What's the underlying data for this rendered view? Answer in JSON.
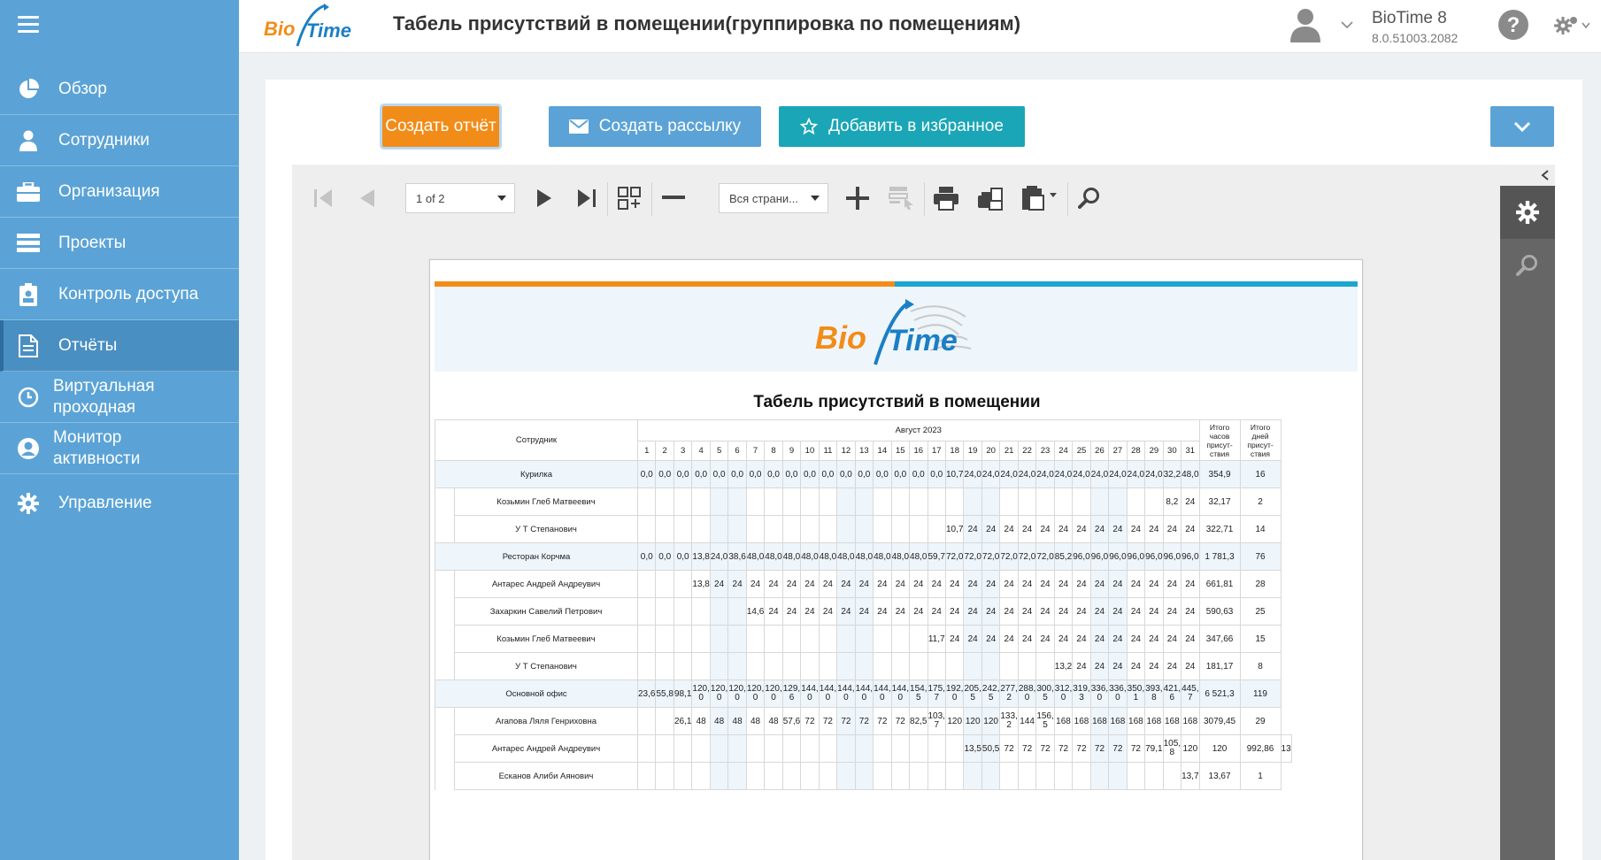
{
  "sidebar": {
    "items": [
      {
        "label": "Обзор",
        "icon": "pie-chart-icon"
      },
      {
        "label": "Сотрудники",
        "icon": "person-icon"
      },
      {
        "label": "Организация",
        "icon": "briefcase-icon"
      },
      {
        "label": "Проекты",
        "icon": "list-icon"
      },
      {
        "label": "Контроль доступа",
        "icon": "badge-icon"
      },
      {
        "label": "Отчёты",
        "icon": "document-icon",
        "active": true
      },
      {
        "label": "Виртуальная\nпроходная",
        "icon": "clock-icon"
      },
      {
        "label": "Монитор\nактивности",
        "icon": "user-circle-icon"
      },
      {
        "label": "Управление",
        "icon": "gear-icon"
      }
    ]
  },
  "header": {
    "title": "Табель присутствий в помещении(группировка по помещениям)",
    "app_name": "BioTime 8",
    "app_version": "8.0.51003.2082",
    "logo_bio": "Bio",
    "logo_time": "Time"
  },
  "actions": {
    "create_report": "Создать отчёт",
    "create_mailing": "Создать рассылку",
    "add_favorite": "Добавить в избранное"
  },
  "toolbar": {
    "page_select": "1 of 2",
    "zoom_select": "Вся страни..."
  },
  "report": {
    "title": "Табель присутствий в помещении",
    "col_employee": "Сотрудник",
    "col_month": "Август 2023",
    "col_total_hours": "Итого\nчасов\nприсут-\nствия",
    "col_total_days": "Итого\nдней\nприсут-\nствия",
    "days": [
      "1",
      "2",
      "3",
      "4",
      "5",
      "6",
      "7",
      "8",
      "9",
      "10",
      "11",
      "12",
      "13",
      "14",
      "15",
      "16",
      "17",
      "18",
      "19",
      "20",
      "21",
      "22",
      "23",
      "24",
      "25",
      "26",
      "27",
      "28",
      "29",
      "30",
      "31"
    ],
    "rows": [
      {
        "type": "group",
        "name": "Курилка",
        "vals": [
          "0,0",
          "0,0",
          "0,0",
          "0,0",
          "0,0",
          "0,0",
          "0,0",
          "0,0",
          "0,0",
          "0,0",
          "0,0",
          "0,0",
          "0,0",
          "0,0",
          "0,0",
          "0,0",
          "0,0",
          "10,7",
          "24,0",
          "24,0",
          "24,0",
          "24,0",
          "24,0",
          "24,0",
          "24,0",
          "24,0",
          "24,0",
          "24,0",
          "24,0",
          "32,2",
          "48,0"
        ],
        "total_hours": "354,9",
        "total_days": "16"
      },
      {
        "type": "emp",
        "name": "Козьмин Глеб Матвеевич",
        "vals": [
          "",
          "",
          "",
          "",
          "",
          "",
          "",
          "",
          "",
          "",
          "",
          "",
          "",
          "",
          "",
          "",
          "",
          "",
          "",
          "",
          "",
          "",
          "",
          "",
          "",
          "",
          "",
          "",
          "",
          "8,2",
          "24"
        ],
        "total_hours": "32,17",
        "total_days": "2"
      },
      {
        "type": "emp",
        "name": "У Т Степанович",
        "vals": [
          "",
          "",
          "",
          "",
          "",
          "",
          "",
          "",
          "",
          "",
          "",
          "",
          "",
          "",
          "",
          "",
          "",
          "10,7",
          "24",
          "24",
          "24",
          "24",
          "24",
          "24",
          "24",
          "24",
          "24",
          "24",
          "24",
          "24",
          "24"
        ],
        "total_hours": "322,71",
        "total_days": "14"
      },
      {
        "type": "group",
        "name": "Ресторан Корчма",
        "vals": [
          "0,0",
          "0,0",
          "0,0",
          "13,8",
          "24,0",
          "38,6",
          "48,0",
          "48,0",
          "48,0",
          "48,0",
          "48,0",
          "48,0",
          "48,0",
          "48,0",
          "48,0",
          "48,0",
          "59,7",
          "72,0",
          "72,0",
          "72,0",
          "72,0",
          "72,0",
          "72,0",
          "85,2",
          "96,0",
          "96,0",
          "96,0",
          "96,0",
          "96,0",
          "96,0",
          "96,0"
        ],
        "total_hours": "1 781,3",
        "total_days": "76"
      },
      {
        "type": "emp",
        "name": "Антарес Андрей Андреувич",
        "vals": [
          "",
          "",
          "",
          "13,8",
          "24",
          "24",
          "24",
          "24",
          "24",
          "24",
          "24",
          "24",
          "24",
          "24",
          "24",
          "24",
          "24",
          "24",
          "24",
          "24",
          "24",
          "24",
          "24",
          "24",
          "24",
          "24",
          "24",
          "24",
          "24",
          "24",
          "24"
        ],
        "total_hours": "661,81",
        "total_days": "28"
      },
      {
        "type": "emp",
        "name": "Захаркин Савелий Петрович",
        "vals": [
          "",
          "",
          "",
          "",
          "",
          "",
          "14,6",
          "24",
          "24",
          "24",
          "24",
          "24",
          "24",
          "24",
          "24",
          "24",
          "24",
          "24",
          "24",
          "24",
          "24",
          "24",
          "24",
          "24",
          "24",
          "24",
          "24",
          "24",
          "24",
          "24",
          "24"
        ],
        "total_hours": "590,63",
        "total_days": "25"
      },
      {
        "type": "emp",
        "name": "Козьмин Глеб Матвеевич",
        "vals": [
          "",
          "",
          "",
          "",
          "",
          "",
          "",
          "",
          "",
          "",
          "",
          "",
          "",
          "",
          "",
          "",
          "11,7",
          "24",
          "24",
          "24",
          "24",
          "24",
          "24",
          "24",
          "24",
          "24",
          "24",
          "24",
          "24",
          "24",
          "24"
        ],
        "total_hours": "347,66",
        "total_days": "15"
      },
      {
        "type": "emp",
        "name": "У Т Степанович",
        "vals": [
          "",
          "",
          "",
          "",
          "",
          "",
          "",
          "",
          "",
          "",
          "",
          "",
          "",
          "",
          "",
          "",
          "",
          "",
          "",
          "",
          "",
          "",
          "",
          "13,2",
          "24",
          "24",
          "24",
          "24",
          "24",
          "24",
          "24"
        ],
        "total_hours": "181,17",
        "total_days": "8"
      },
      {
        "type": "group",
        "name": "Основной офис",
        "vals": [
          "23,6",
          "55,8",
          "98,1",
          "120,\n0",
          "120,\n0",
          "120,\n0",
          "120,\n0",
          "120,\n0",
          "129,\n6",
          "144,\n0",
          "144,\n0",
          "144,\n0",
          "144,\n0",
          "144,\n0",
          "144,\n0",
          "154,\n5",
          "175,\n7",
          "192,\n0",
          "205,\n5",
          "242,\n5",
          "277,\n2",
          "288,\n0",
          "300,\n5",
          "312,\n0",
          "319,\n3",
          "336,\n0",
          "336,\n0",
          "350,\n1",
          "393,\n8",
          "421,\n6",
          "445,\n7"
        ],
        "total_hours": "6 521,3",
        "total_days": "119"
      },
      {
        "type": "emp",
        "name": "Агапова Ляля Генриховна",
        "vals": [
          "",
          "",
          "26,1",
          "48",
          "48",
          "48",
          "48",
          "48",
          "57,6",
          "72",
          "72",
          "72",
          "72",
          "72",
          "72",
          "82,5",
          "103,\n7",
          "120",
          "120",
          "120",
          "133,\n2",
          "144",
          "156,\n5",
          "168",
          "168",
          "168",
          "168",
          "168",
          "168",
          "168",
          "168"
        ],
        "total_hours": "3079,45",
        "total_days": "29"
      },
      {
        "type": "emp",
        "name": "Антарес Андрей Андреувич",
        "vals": [
          "",
          "",
          "",
          "",
          "",
          "",
          "",
          "",
          "",
          "",
          "",
          "",
          "",
          "",
          "",
          "",
          "",
          "",
          "13,5",
          "50,5",
          "72",
          "72",
          "72",
          "72",
          "72",
          "72",
          "72",
          "72",
          "79,1",
          "105,\n8",
          "120",
          "120"
        ],
        "total_hours": "992,86",
        "total_days": "13"
      },
      {
        "type": "emp",
        "name": "Есканов Алиби Аянович",
        "vals": [
          "",
          "",
          "",
          "",
          "",
          "",
          "",
          "",
          "",
          "",
          "",
          "",
          "",
          "",
          "",
          "",
          "",
          "",
          "",
          "",
          "",
          "",
          "",
          "",
          "",
          "",
          "",
          "",
          "",
          "",
          "13,7"
        ],
        "total_hours": "13,67",
        "total_days": "1"
      }
    ]
  },
  "colors": {
    "sidebar": "#5ba3d6",
    "orange": "#f28c18",
    "teal": "#1aa6b7",
    "blue": "#5ba3d6"
  }
}
